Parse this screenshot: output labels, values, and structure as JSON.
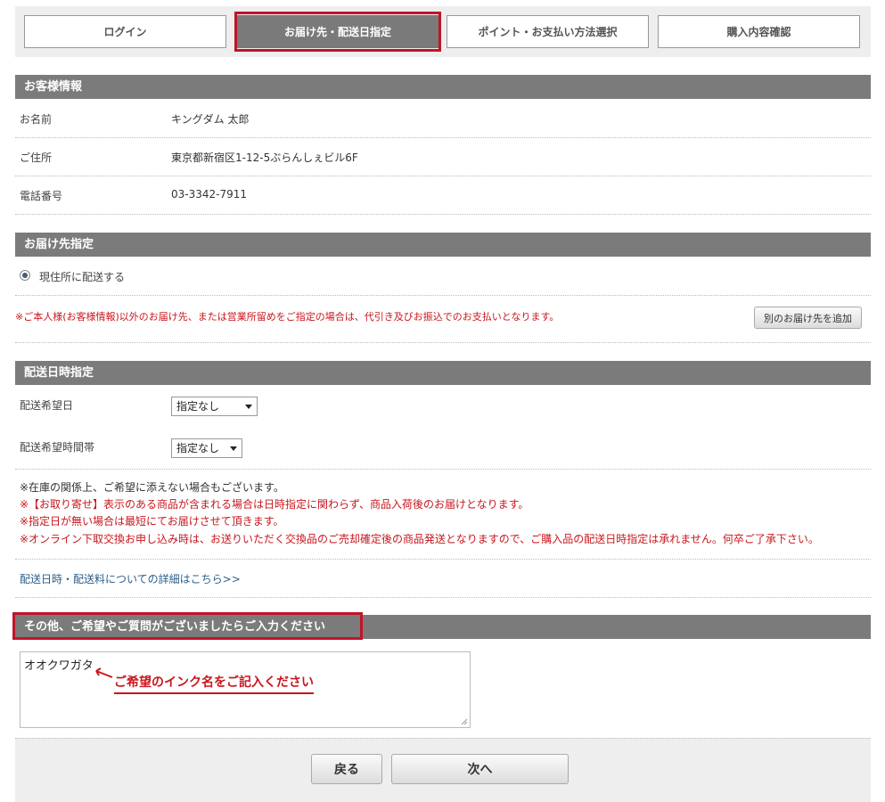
{
  "steps": [
    {
      "label": "ログイン",
      "active": false
    },
    {
      "label": "お届け先・配送日指定",
      "active": true
    },
    {
      "label": "ポイント・お支払い方法選択",
      "active": false
    },
    {
      "label": "購入内容確認",
      "active": false
    }
  ],
  "customer": {
    "header": "お客様情報",
    "name_label": "お名前",
    "name_value": "キングダム 太郎",
    "address_label": "ご住所",
    "address_value": "東京都新宿区1-12-5ぶらんしぇビル6F",
    "phone_label": "電話番号",
    "phone_value": "03-3342-7911"
  },
  "delivery": {
    "header": "お届け先指定",
    "radio_label": "現住所に配送する",
    "notice": "※ご本人様(お客様情報)以外のお届け先、または営業所留めをご指定の場合は、代引き及びお振込でのお支払いとなります。",
    "add_button": "別のお届け先を追加"
  },
  "schedule": {
    "header": "配送日時指定",
    "date_label": "配送希望日",
    "date_value": "指定なし",
    "time_label": "配送希望時間帯",
    "time_value": "指定なし",
    "notes": [
      "※在庫の関係上、ご希望に添えない場合もございます。",
      "※【お取り寄せ】表示のある商品が含まれる場合は日時指定に関わらず、商品入荷後のお届けとなります。",
      "※指定日が無い場合は最短にてお届けさせて頂きます。",
      "※オンライン下取交換お申し込み時は、お送りいただく交換品のご売却確定後の商品発送となりますので、ご購入品の配送日時指定は承れません。何卒ご了承下さい。"
    ],
    "details_link": "配送日時・配送料についての詳細はこちら>>"
  },
  "comments": {
    "header": "その他、ご希望やご質問がございましたらご入力ください",
    "text": "オオクワガタ",
    "annotation": "ご希望のインク名をご記入ください"
  },
  "footer": {
    "back_button": "戻る",
    "next_button": "次へ"
  },
  "colors": {
    "accent_red": "#c0142a",
    "bar_gray": "#7b7b7b",
    "link_blue": "#2a5d8a"
  }
}
